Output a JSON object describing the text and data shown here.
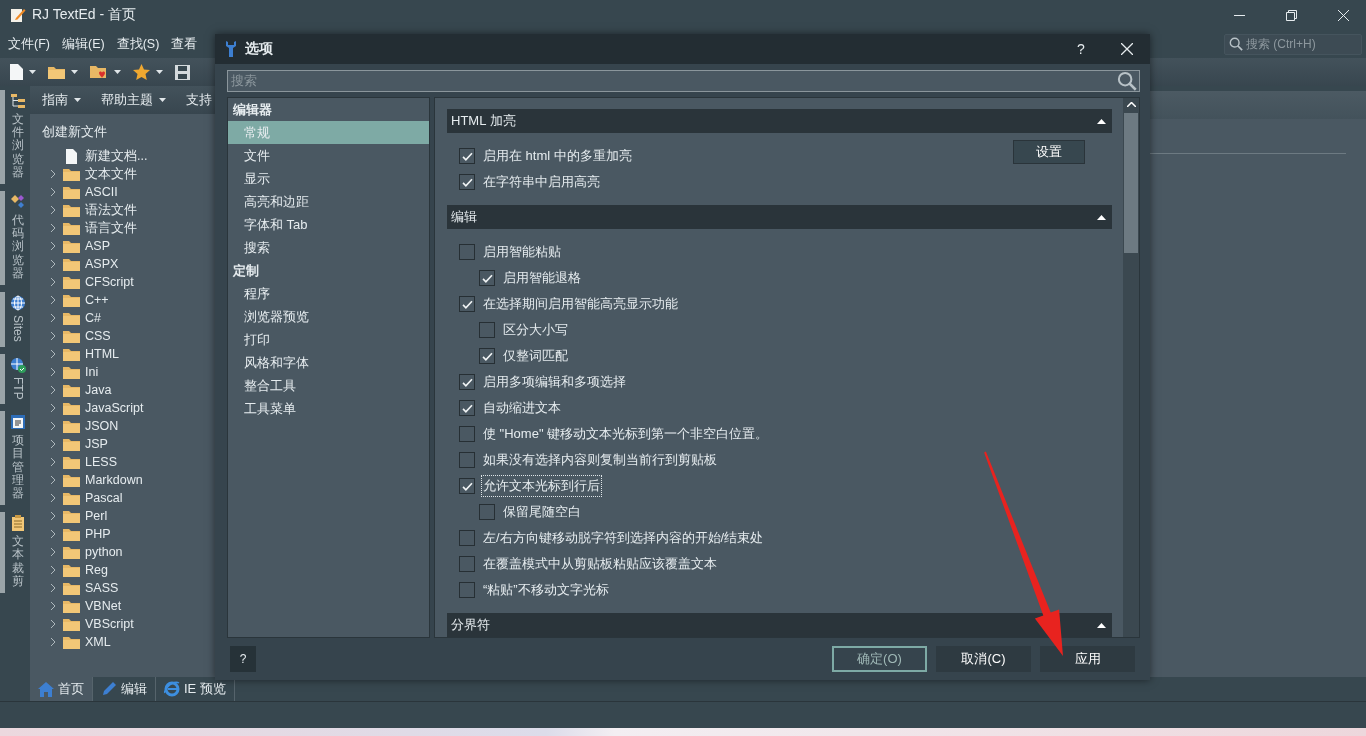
{
  "window": {
    "title": "RJ TextEd - 首页"
  },
  "menu": [
    "文件(F)",
    "编辑(E)",
    "查找(S)",
    "查看"
  ],
  "search": {
    "placeholder": "搜索 (Ctrl+H)"
  },
  "side_tabs": [
    {
      "label": "文件浏览器",
      "kind": "cjk"
    },
    {
      "label": "代码浏览器",
      "kind": "cjk"
    },
    {
      "label": "Sites",
      "kind": "latin"
    },
    {
      "label": "FTP",
      "kind": "latin"
    },
    {
      "label": "项目管理器",
      "kind": "cjk"
    },
    {
      "label": "文本裁剪",
      "kind": "cjk"
    }
  ],
  "panel_toolbar": [
    {
      "label": "指南",
      "dropdown": true
    },
    {
      "label": "帮助主题",
      "dropdown": true
    },
    {
      "label": "支持",
      "dropdown": false
    }
  ],
  "file_tree": {
    "title": "创建新文件",
    "items": [
      {
        "label": "新建文档...",
        "kind": "file"
      },
      {
        "label": "文本文件",
        "kind": "folder",
        "expanded": false
      },
      {
        "label": "ASCII",
        "kind": "folder",
        "expanded": false
      },
      {
        "label": "语法文件",
        "kind": "folder",
        "expanded": false
      },
      {
        "label": "语言文件",
        "kind": "folder",
        "expanded": false
      },
      {
        "label": "ASP",
        "kind": "folder",
        "expanded": false
      },
      {
        "label": "ASPX",
        "kind": "folder",
        "expanded": false
      },
      {
        "label": "CFScript",
        "kind": "folder",
        "expanded": false
      },
      {
        "label": "C++",
        "kind": "folder",
        "expanded": false
      },
      {
        "label": "C#",
        "kind": "folder",
        "expanded": false
      },
      {
        "label": "CSS",
        "kind": "folder",
        "expanded": false
      },
      {
        "label": "HTML",
        "kind": "folder",
        "expanded": false
      },
      {
        "label": "Ini",
        "kind": "folder",
        "expanded": false
      },
      {
        "label": "Java",
        "kind": "folder",
        "expanded": false
      },
      {
        "label": "JavaScript",
        "kind": "folder",
        "expanded": false
      },
      {
        "label": "JSON",
        "kind": "folder",
        "expanded": false
      },
      {
        "label": "JSP",
        "kind": "folder",
        "expanded": false
      },
      {
        "label": "LESS",
        "kind": "folder",
        "expanded": false
      },
      {
        "label": "Markdown",
        "kind": "folder",
        "expanded": false
      },
      {
        "label": "Pascal",
        "kind": "folder",
        "expanded": false
      },
      {
        "label": "Perl",
        "kind": "folder",
        "expanded": false
      },
      {
        "label": "PHP",
        "kind": "folder",
        "expanded": false
      },
      {
        "label": "python",
        "kind": "folder",
        "expanded": false
      },
      {
        "label": "Reg",
        "kind": "folder",
        "expanded": false
      },
      {
        "label": "SASS",
        "kind": "folder",
        "expanded": false
      },
      {
        "label": "VBNet",
        "kind": "folder",
        "expanded": false
      },
      {
        "label": "VBScript",
        "kind": "folder",
        "expanded": false
      },
      {
        "label": "XML",
        "kind": "folder",
        "expanded": false
      }
    ]
  },
  "doc_tabs": [
    {
      "label": "首页",
      "selected": true
    },
    {
      "label": "编辑",
      "selected": false
    },
    {
      "label": "IE 预览",
      "selected": false
    }
  ],
  "dialog": {
    "title": "选项",
    "help": "?",
    "search": {
      "placeholder": "搜索"
    },
    "nav": [
      {
        "label": "编辑器",
        "children": [
          {
            "label": "常规",
            "selected": true
          },
          {
            "label": "文件",
            "selected": false
          },
          {
            "label": "显示",
            "selected": false
          },
          {
            "label": "高亮和边距",
            "selected": false
          },
          {
            "label": "字体和 Tab",
            "selected": false
          },
          {
            "label": "搜索",
            "selected": false
          }
        ]
      },
      {
        "label": "定制",
        "children": [
          {
            "label": "程序",
            "selected": false
          },
          {
            "label": "浏览器预览",
            "selected": false
          },
          {
            "label": "打印",
            "selected": false
          },
          {
            "label": "风格和字体",
            "selected": false
          },
          {
            "label": "整合工具",
            "selected": false
          },
          {
            "label": "工具菜单",
            "selected": false
          }
        ]
      }
    ],
    "sections": [
      {
        "title": "HTML 加亮",
        "expanded": true,
        "button": "设置",
        "options": [
          {
            "label": "启用在 html 中的多重加亮",
            "checked": true,
            "focused": false
          },
          {
            "label": "在字符串中启用高亮",
            "checked": true,
            "focused": false
          }
        ]
      },
      {
        "title": "编辑",
        "expanded": true,
        "options": [
          {
            "label": "启用智能粘贴",
            "checked": false,
            "focused": false,
            "children": [
              {
                "label": "启用智能退格",
                "checked": true,
                "focused": false
              }
            ]
          },
          {
            "label": "在选择期间启用智能高亮显示功能",
            "checked": true,
            "focused": false,
            "children": [
              {
                "label": "区分大小写",
                "checked": false,
                "focused": false
              },
              {
                "label": "仅整词匹配",
                "checked": true,
                "focused": false
              }
            ]
          },
          {
            "label": "启用多项编辑和多项选择",
            "checked": true,
            "focused": false
          },
          {
            "label": "自动缩进文本",
            "checked": true,
            "focused": false
          },
          {
            "label": "使 \"Home\" 键移动文本光标到第一个非空白位置。",
            "checked": false,
            "focused": false
          },
          {
            "label": "如果没有选择内容则复制当前行到剪贴板",
            "checked": false,
            "focused": false
          },
          {
            "label": "允许文本光标到行后",
            "checked": true,
            "focused": true,
            "children": [
              {
                "label": "保留尾随空白",
                "checked": false,
                "focused": false
              }
            ]
          },
          {
            "label": "左/右方向键移动脱字符到选择内容的开始/结束处",
            "checked": false,
            "focused": false
          },
          {
            "label": "在覆盖模式中从剪贴板粘贴应该覆盖文本",
            "checked": false,
            "focused": false
          },
          {
            "label": "“粘贴”不移动文字光标",
            "checked": false,
            "focused": false
          }
        ]
      },
      {
        "title": "分界符",
        "expanded": true
      }
    ],
    "help_button": "?",
    "buttons": [
      {
        "label": "确定(O)",
        "kind": "default"
      },
      {
        "label": "取消(C)",
        "kind": "normal"
      },
      {
        "label": "应用",
        "kind": "normal"
      }
    ]
  }
}
